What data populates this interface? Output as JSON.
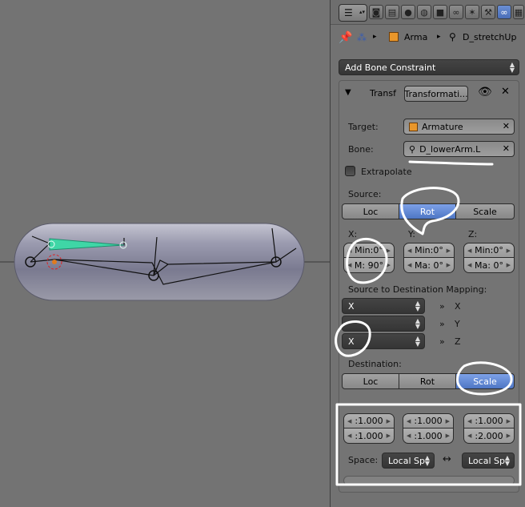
{
  "header": {
    "breadcrumb": {
      "object": "Arma",
      "bone": "D_stretchUp"
    }
  },
  "constraints": {
    "add_label": "Add Bone Constraint",
    "panel": {
      "name": "Transf",
      "type_label": "Transformati...",
      "target_label": "Target:",
      "target_value": "Armature",
      "bone_label": "Bone:",
      "bone_value": "D_lowerArm.L",
      "extrapolate_label": "Extrapolate",
      "source_label": "Source:",
      "source_tabs": [
        "Loc",
        "Rot",
        "Scale"
      ],
      "source_active": "Rot",
      "axis_labels": [
        "X:",
        "Y:",
        "Z:"
      ],
      "source_ranges": [
        {
          "min": "Min:0°",
          "max": "M: 90°"
        },
        {
          "min": "Min:0°",
          "max": "Ma: 0°"
        },
        {
          "min": "Min:0°",
          "max": "Ma: 0°"
        }
      ],
      "mapping_label": "Source to Destination Mapping:",
      "mapping": [
        {
          "from": "X",
          "to": "X"
        },
        {
          "from": "",
          "to": "Y"
        },
        {
          "from": "X",
          "to": "Z"
        }
      ],
      "mapping_arrow": "»",
      "destination_label": "Destination:",
      "dest_tabs": [
        "Loc",
        "Rot",
        "Scale"
      ],
      "dest_active": "Scale",
      "dest_ranges": [
        {
          "a": ":1.000",
          "b": ":1.000"
        },
        {
          "a": ":1.000",
          "b": ":1.000"
        },
        {
          "a": ":1.000",
          "b": ":2.000"
        }
      ],
      "space_label": "Space:",
      "space_from": "Local Sp",
      "space_to": "Local Sp",
      "space_swap": "↔"
    }
  },
  "colors": {
    "accent_active": "#5a80cf",
    "bone_selected": "#3fd6a6",
    "annotation": "#ffffff"
  }
}
